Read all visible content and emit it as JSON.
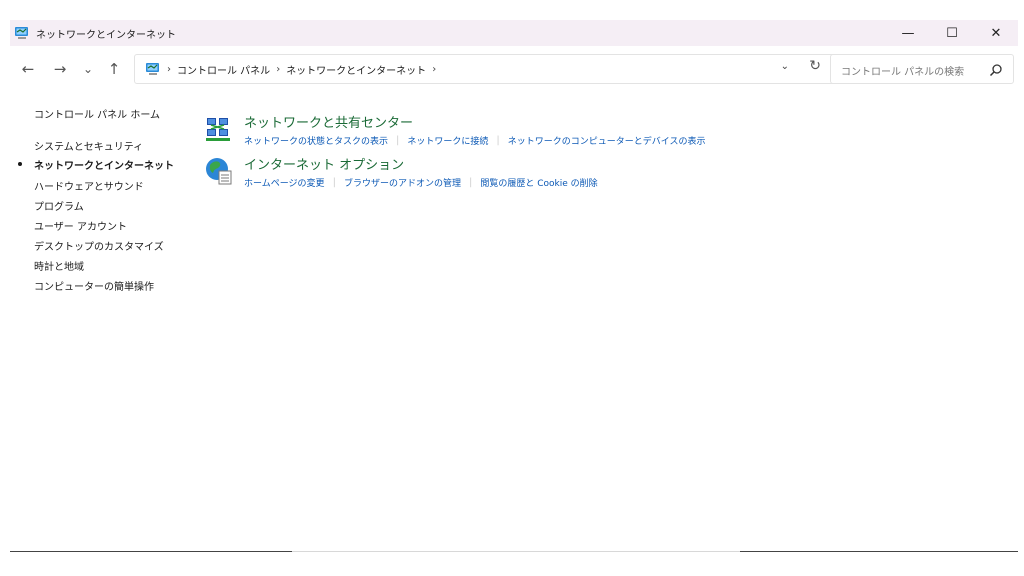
{
  "window": {
    "title": "ネットワークとインターネット",
    "minimize_glyph": "—",
    "maximize_glyph": "☐",
    "close_glyph": "✕"
  },
  "nav": {
    "back_glyph": "←",
    "forward_glyph": "→",
    "recent_glyph": "⌄",
    "up_glyph": "↑",
    "breadcrumb": [
      "コントロール パネル",
      "ネットワークとインターネット"
    ],
    "breadcrumb_sep": "›",
    "dropdown_glyph": "⌄",
    "refresh_glyph": "↻"
  },
  "search": {
    "placeholder": "コントロール パネルの検索"
  },
  "sidebar": {
    "items": [
      {
        "label": "コントロール パネル ホーム",
        "bold": false
      },
      {
        "label": "システムとセキュリティ",
        "bold": false
      },
      {
        "label": "ネットワークとインターネット",
        "bold": true,
        "current": true
      },
      {
        "label": "ハードウェアとサウンド",
        "bold": false
      },
      {
        "label": "プログラム",
        "bold": false
      },
      {
        "label": "ユーザー アカウント",
        "bold": false
      },
      {
        "label": "デスクトップのカスタマイズ",
        "bold": false
      },
      {
        "label": "時計と地域",
        "bold": false
      },
      {
        "label": "コンピューターの簡単操作",
        "bold": false
      }
    ]
  },
  "categories": [
    {
      "title": "ネットワークと共有センター",
      "icon": "network-sharing-icon",
      "links": [
        "ネットワークの状態とタスクの表示",
        "ネットワークに接続",
        "ネットワークのコンピューターとデバイスの表示"
      ]
    },
    {
      "title": "インターネット オプション",
      "icon": "internet-options-icon",
      "links": [
        "ホームページの変更",
        "ブラウザーのアドオンの管理",
        "閲覧の履歴と Cookie の削除"
      ]
    }
  ],
  "colors": {
    "titlebar_bg": "#f5eef5",
    "category_title": "#1a6a36",
    "link": "#0b58b5"
  }
}
